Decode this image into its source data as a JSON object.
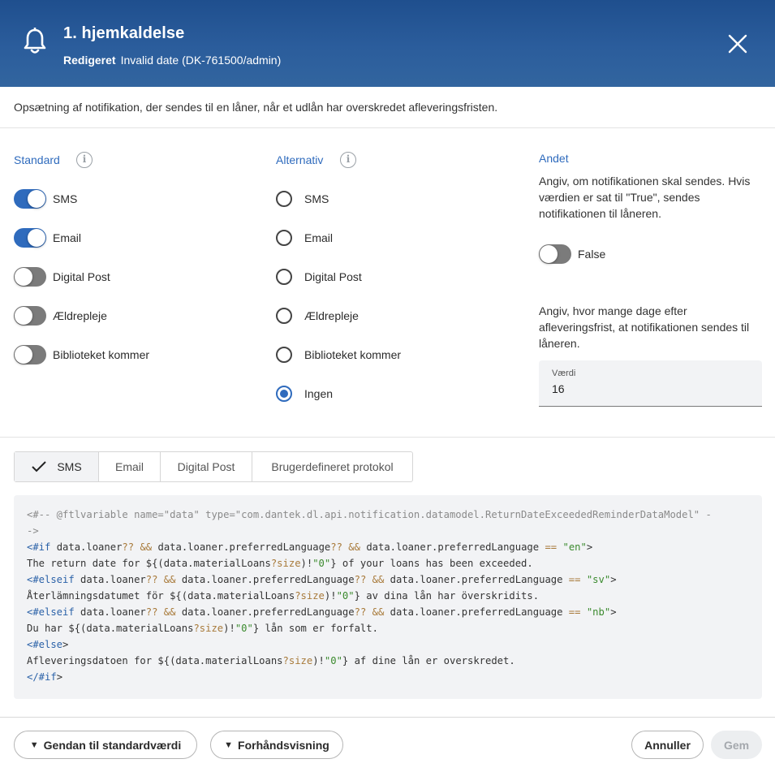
{
  "header": {
    "title": "1. hjemkaldelse",
    "status_label": "Redigeret",
    "status_detail": "Invalid date (DK-761500/admin)",
    "icon": "bell-icon",
    "close_icon": "close-icon"
  },
  "description": "Opsætning af notifikation, der sendes til en låner, når et udlån har overskredet afleveringsfristen.",
  "standard": {
    "heading": "Standard",
    "items": [
      {
        "label": "SMS",
        "on": true
      },
      {
        "label": "Email",
        "on": true
      },
      {
        "label": "Digital Post",
        "on": false
      },
      {
        "label": "Ældrepleje",
        "on": false
      },
      {
        "label": "Biblioteket kommer",
        "on": false
      }
    ]
  },
  "alternativ": {
    "heading": "Alternativ",
    "items": [
      {
        "label": "SMS",
        "checked": false
      },
      {
        "label": "Email",
        "checked": false
      },
      {
        "label": "Digital Post",
        "checked": false
      },
      {
        "label": "Ældrepleje",
        "checked": false
      },
      {
        "label": "Biblioteket kommer",
        "checked": false
      },
      {
        "label": "Ingen",
        "checked": true
      }
    ]
  },
  "andet": {
    "heading": "Andet",
    "send_text": "Angiv, om notifikationen skal sendes. Hvis værdien er sat til \"True\", sendes notifikationen til låneren.",
    "send_toggle_label": "False",
    "send_toggle_on": false,
    "days_text": "Angiv, hvor mange dage efter afleveringsfrist, at notifikationen sendes til låneren.",
    "value_label": "Værdi",
    "value": "16"
  },
  "tabs": [
    {
      "label": "SMS",
      "active": true
    },
    {
      "label": "Email",
      "active": false
    },
    {
      "label": "Digital Post",
      "active": false
    },
    {
      "label": "Brugerdefineret protokol",
      "active": false
    }
  ],
  "code": {
    "lines": [
      "<#-- @ftlvariable name=\"data\" type=\"com.dantek.dl.api.notification.datamodel.ReturnDateExceededReminderDataModel\" -",
      "->",
      "<#if data.loaner?? && data.loaner.preferredLanguage?? && data.loaner.preferredLanguage == \"en\">",
      "The return date for ${(data.materialLoans?size)!\"0\"} of your loans has been exceeded.",
      "<#elseif data.loaner?? && data.loaner.preferredLanguage?? && data.loaner.preferredLanguage == \"sv\">",
      "Återlämningsdatumet för ${(data.materialLoans?size)!\"0\"} av dina lån har överskridits.",
      "<#elseif data.loaner?? && data.loaner.preferredLanguage?? && data.loaner.preferredLanguage == \"nb\">",
      "Du har ${(data.materialLoans?size)!\"0\"} lån som er forfalt.",
      "<#else>",
      "Afleveringsdatoen for ${(data.materialLoans?size)!\"0\"} af dine lån er overskredet.",
      "</#if>"
    ]
  },
  "footer": {
    "reset_label": "Gendan til standardværdi",
    "preview_label": "Forhåndsvisning",
    "cancel_label": "Annuller",
    "save_label": "Gem"
  },
  "colors": {
    "header": "#2b5d9c",
    "accent": "#2f6bbd",
    "toggle_off": "#7b7b7b"
  }
}
